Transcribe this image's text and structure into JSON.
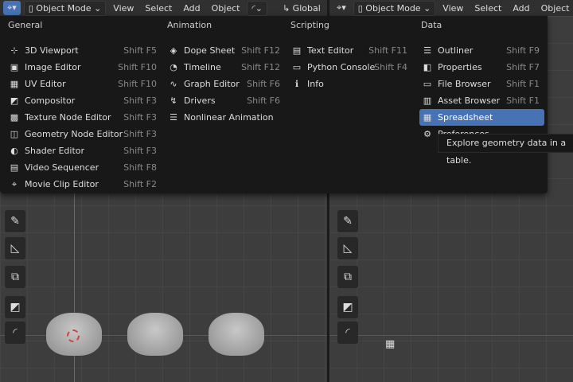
{
  "header_left": {
    "editor_icon": "editor-type-icon",
    "mode": "Object Mode",
    "menus": [
      "View",
      "Select",
      "Add",
      "Object"
    ],
    "orientation": "Global"
  },
  "header_right": {
    "editor_icon": "editor-type-icon",
    "mode": "Object Mode",
    "menus": [
      "View",
      "Select",
      "Add",
      "Object"
    ]
  },
  "menu": {
    "columns": [
      {
        "title": "General",
        "items": [
          {
            "label": "3D Viewport",
            "shortcut": "Shift F5",
            "icon": "⊹"
          },
          {
            "label": "Image Editor",
            "shortcut": "Shift F10",
            "icon": "▣"
          },
          {
            "label": "UV Editor",
            "shortcut": "Shift F10",
            "icon": "▦"
          },
          {
            "label": "Compositor",
            "shortcut": "Shift F3",
            "icon": "◩"
          },
          {
            "label": "Texture Node Editor",
            "shortcut": "Shift F3",
            "icon": "▩"
          },
          {
            "label": "Geometry Node Editor",
            "shortcut": "Shift F3",
            "icon": "◫"
          },
          {
            "label": "Shader Editor",
            "shortcut": "Shift F3",
            "icon": "◐"
          },
          {
            "label": "Video Sequencer",
            "shortcut": "Shift F8",
            "icon": "▤"
          },
          {
            "label": "Movie Clip Editor",
            "shortcut": "Shift F2",
            "icon": "⌖"
          }
        ]
      },
      {
        "title": "Animation",
        "items": [
          {
            "label": "Dope Sheet",
            "shortcut": "Shift F12",
            "icon": "◈"
          },
          {
            "label": "Timeline",
            "shortcut": "Shift F12",
            "icon": "◔"
          },
          {
            "label": "Graph Editor",
            "shortcut": "Shift F6",
            "icon": "∿"
          },
          {
            "label": "Drivers",
            "shortcut": "Shift F6",
            "icon": "↯"
          },
          {
            "label": "Nonlinear Animation",
            "shortcut": "",
            "icon": "☰"
          }
        ]
      },
      {
        "title": "Scripting",
        "items": [
          {
            "label": "Text Editor",
            "shortcut": "Shift F11",
            "icon": "▤"
          },
          {
            "label": "Python Console",
            "shortcut": "Shift F4",
            "icon": "▭"
          },
          {
            "label": "Info",
            "shortcut": "",
            "icon": "ℹ"
          }
        ]
      },
      {
        "title": "Data",
        "items": [
          {
            "label": "Outliner",
            "shortcut": "Shift F9",
            "icon": "☰"
          },
          {
            "label": "Properties",
            "shortcut": "Shift F7",
            "icon": "◧"
          },
          {
            "label": "File Browser",
            "shortcut": "Shift F1",
            "icon": "▭"
          },
          {
            "label": "Asset Browser",
            "shortcut": "Shift F1",
            "icon": "▥"
          },
          {
            "label": "Spreadsheet",
            "shortcut": "",
            "icon": "▦",
            "selected": true
          },
          {
            "label": "Preferences",
            "shortcut": "",
            "icon": "⚙"
          }
        ]
      }
    ]
  },
  "tooltip": "Explore geometry data in a table."
}
